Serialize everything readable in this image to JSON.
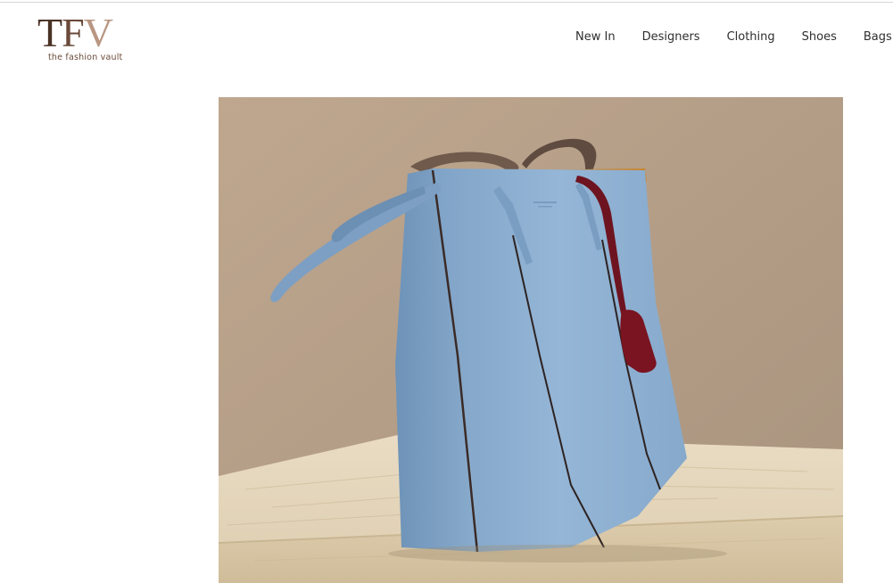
{
  "brand": {
    "mark_t": "T",
    "mark_f": "F",
    "mark_v": "V",
    "tagline": "the fashion vault",
    "colors": {
      "dark": "#4a3225",
      "mid": "#6b4a39",
      "light": "#b89682"
    }
  },
  "nav": {
    "items": [
      {
        "label": "New In"
      },
      {
        "label": "Designers"
      },
      {
        "label": "Clothing"
      },
      {
        "label": "Shoes"
      },
      {
        "label": "Bags"
      }
    ]
  },
  "hero": {
    "subject": "light blue leather tote bag on travertine pedestal",
    "colors": {
      "wall": "#b39e88",
      "bag": "#8fb1d2",
      "pedestal": "#e6d8bd",
      "tag": "#7a1420"
    }
  }
}
